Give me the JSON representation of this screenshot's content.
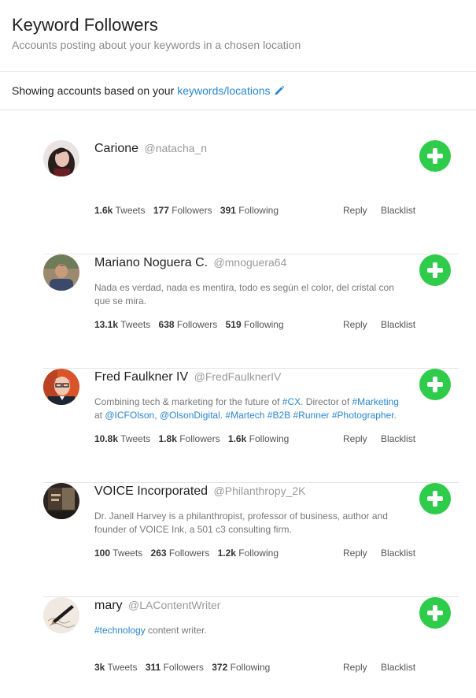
{
  "header": {
    "title": "Keyword Followers",
    "subtitle": "Accounts posting about your keywords in a chosen location"
  },
  "info_bar": {
    "prefix": "Showing accounts based on your",
    "link": "keywords/locations",
    "edit_icon": "pencil-icon"
  },
  "labels": {
    "tweets": "Tweets",
    "followers": "Followers",
    "following": "Following",
    "reply": "Reply",
    "blacklist": "Blacklist",
    "follow_icon": "plus-icon"
  },
  "colors": {
    "accent": "#2a86d0",
    "follow": "#2fcb4a"
  },
  "accounts": [
    {
      "name": "Carione",
      "handle": "@natacha_n",
      "bio": [],
      "tweets": "1.6k",
      "followers": "177",
      "following": "391"
    },
    {
      "name": "Mariano Noguera C.",
      "handle": "@mnoguera64",
      "bio": [
        {
          "text": "Nada es verdad, nada es mentira, todo es según el color, del cristal con que se mira.",
          "link": false
        }
      ],
      "tweets": "13.1k",
      "followers": "638",
      "following": "519"
    },
    {
      "name": "Fred Faulkner IV",
      "handle": "@FredFaulknerIV",
      "bio": [
        {
          "text": "Combining tech & marketing for the future of ",
          "link": false
        },
        {
          "text": "#CX",
          "link": true
        },
        {
          "text": ". Director of ",
          "link": false
        },
        {
          "text": "#Marketing",
          "link": true
        },
        {
          "text": " at ",
          "link": false
        },
        {
          "text": "@ICFOlson",
          "link": true
        },
        {
          "text": ", ",
          "link": false
        },
        {
          "text": "@OlsonDigital",
          "link": true
        },
        {
          "text": ". ",
          "link": false
        },
        {
          "text": "#Martech",
          "link": true
        },
        {
          "text": " ",
          "link": false
        },
        {
          "text": "#B2B",
          "link": true
        },
        {
          "text": " ",
          "link": false
        },
        {
          "text": "#Runner",
          "link": true
        },
        {
          "text": " ",
          "link": false
        },
        {
          "text": "#Photographer",
          "link": true
        },
        {
          "text": ".",
          "link": false
        }
      ],
      "tweets": "10.8k",
      "followers": "1.8k",
      "following": "1.6k"
    },
    {
      "name": "VOICE Incorporated",
      "handle": "@Philanthropy_2K",
      "bio": [
        {
          "text": "Dr. Janell Harvey is a philanthropist, professor of business, author and founder of VOICE Ink, a 501 c3 consulting firm.",
          "link": false
        }
      ],
      "tweets": "100",
      "followers": "263",
      "following": "1.2k"
    },
    {
      "name": "mary",
      "handle": "@LAContentWriter",
      "bio": [
        {
          "text": "#technology",
          "link": true
        },
        {
          "text": " content writer.",
          "link": false
        }
      ],
      "tweets": "3k",
      "followers": "311",
      "following": "372"
    }
  ]
}
